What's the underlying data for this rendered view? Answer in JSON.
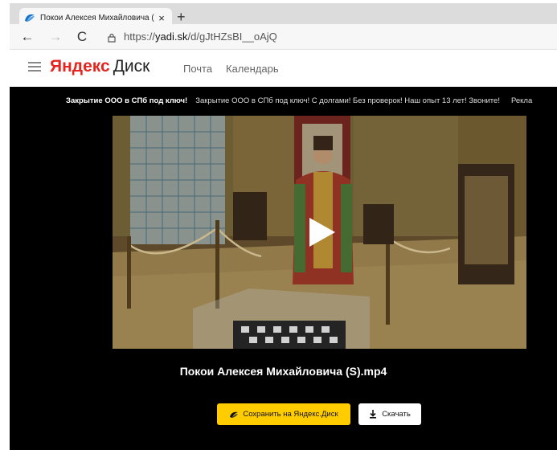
{
  "browser": {
    "tab_title": "Покои Алексея Михайловича (",
    "tab_close": "×",
    "new_tab": "+",
    "nav_back": "←",
    "nav_forward": "→",
    "nav_reload": "C",
    "url_scheme": "https://",
    "url_host": "yadi.sk",
    "url_path": "/d/gJtHZsBI__oAjQ"
  },
  "header": {
    "logo_brand": "Яндекс",
    "logo_product": "Диск",
    "links": [
      "Почта",
      "Календарь"
    ]
  },
  "ad": {
    "title": "Закрытие ООО в СПб под ключ!",
    "text": "Закрытие ООО в СПб под ключ! С долгами! Без проверок! Наш опыт 13 лет! Звоните!",
    "label": "Рекла"
  },
  "file": {
    "name": "Покои Алексея Михайловича (S).mp4"
  },
  "actions": {
    "save_label": "Сохранить на Яндекс.Диск",
    "download_label": "Скачать"
  },
  "colors": {
    "accent": "#ffcc00",
    "brand_red": "#e52620",
    "viewer_bg": "#000000"
  }
}
